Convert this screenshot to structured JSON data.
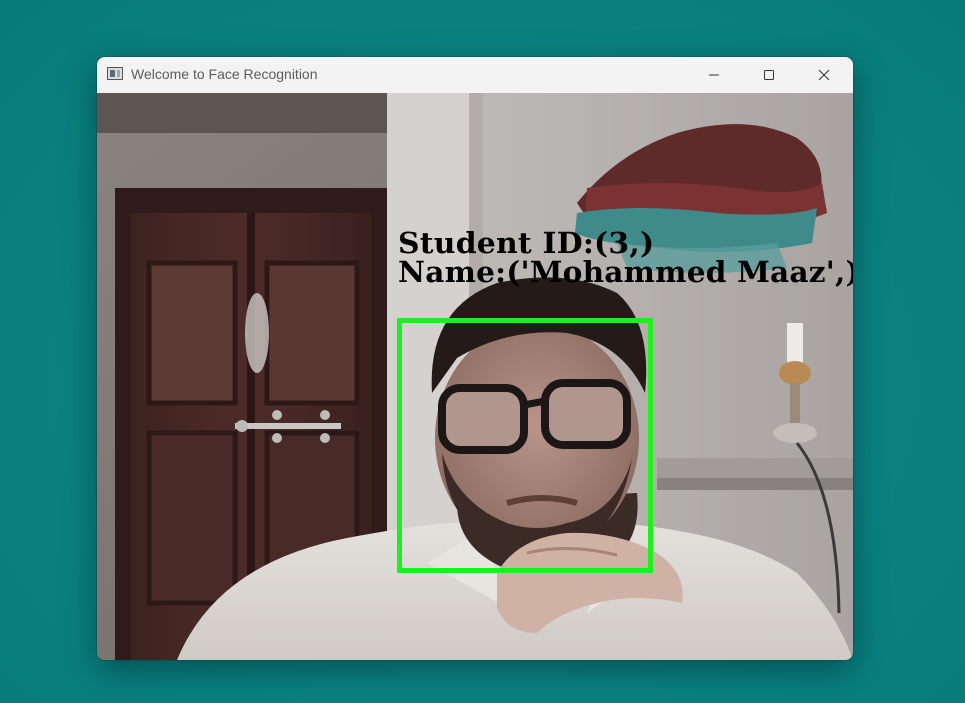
{
  "window": {
    "title": "Welcome to Face Recognition",
    "controls": {
      "minimize_icon": "minimize-icon",
      "maximize_icon": "maximize-icon",
      "close_icon": "close-icon"
    }
  },
  "recognition": {
    "student_id_text": "Student ID:(3,)",
    "name_text": "Name:('Mohammed Maaz',)",
    "box_color": "#1ef01e"
  },
  "colors": {
    "desktop_background": "#0b8585",
    "titlebar_background": "#f3f3f3"
  }
}
